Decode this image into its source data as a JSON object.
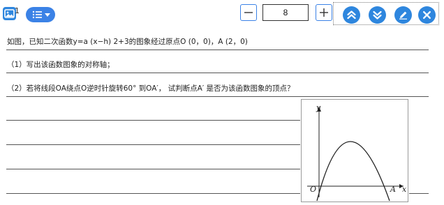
{
  "toolbar": {
    "question_number": "1",
    "image_icon": "image-icon",
    "list_menu_icon": "list-menu-icon",
    "font_size_value": "8",
    "minus_icon": "minus-icon",
    "plus_icon": "plus-icon",
    "action_icons": [
      "collapse-up-icon",
      "expand-down-icon",
      "edit-pencil-icon",
      "close-icon"
    ],
    "accent_color": "#2e86de"
  },
  "question": {
    "stem": "如图，已知二次函数y=a (x−h) 2+3的图象经过原点O (0，0)，A (2，0)",
    "part1": "（1）写出该函数图象的对称轴；",
    "part2": "（2）若将线段OA绕点O逆时针旋转60° 到OA′， 试判断点A′ 是否为该函数图象的顶点？"
  },
  "graph": {
    "y_label": "y",
    "origin_label": "O",
    "a_label": "A",
    "x_label": "x"
  }
}
